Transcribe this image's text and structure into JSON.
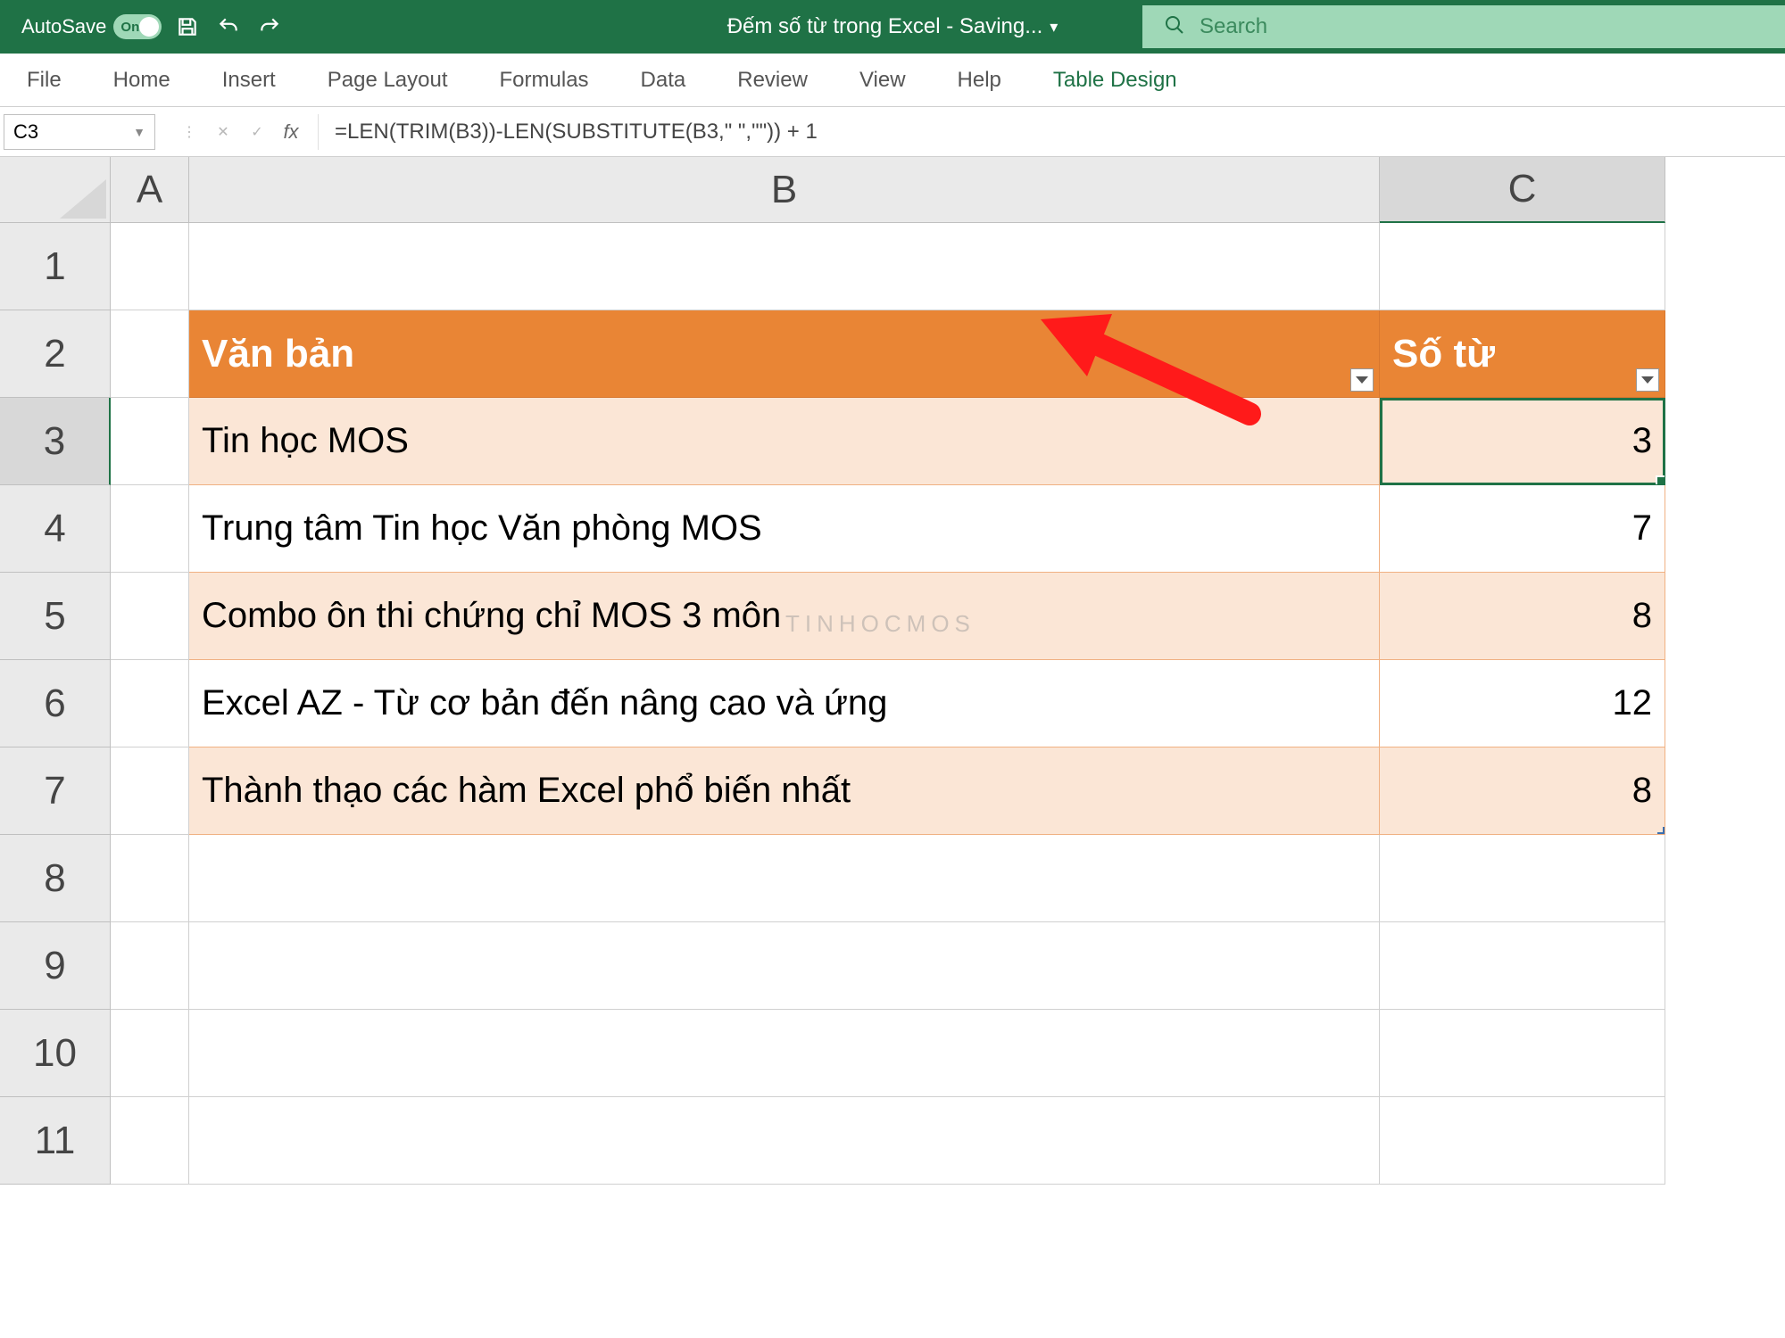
{
  "titlebar": {
    "autosave_label": "AutoSave",
    "toggle_label": "On",
    "doc_title": "Đếm số từ trong Excel  -  Saving..."
  },
  "search": {
    "placeholder": "Search"
  },
  "ribbon": {
    "tabs": [
      "File",
      "Home",
      "Insert",
      "Page Layout",
      "Formulas",
      "Data",
      "Review",
      "View",
      "Help",
      "Table Design"
    ],
    "active_index": 9
  },
  "namebox": {
    "value": "C3"
  },
  "formula": {
    "value": "=LEN(TRIM(B3))-LEN(SUBSTITUTE(B3,\" \",\"\")) + 1"
  },
  "column_headers": [
    "A",
    "B",
    "C"
  ],
  "row_headers": [
    "1",
    "2",
    "3",
    "4",
    "5",
    "6",
    "7",
    "8",
    "9",
    "10",
    "11"
  ],
  "table": {
    "header": {
      "col_b": "Văn bản",
      "col_c": "Số từ"
    },
    "rows": [
      {
        "text": "Tin học MOS",
        "count": "3"
      },
      {
        "text": "Trung tâm Tin học Văn phòng MOS",
        "count": "7"
      },
      {
        "text": "Combo ôn thi chứng chỉ MOS 3 môn",
        "count": "8"
      },
      {
        "text": "Excel AZ - Từ cơ bản đến nâng cao và ứng",
        "count": "12"
      },
      {
        "text": "Thành thạo các hàm Excel phổ biến nhất",
        "count": "8"
      }
    ]
  },
  "watermark": "TINHOCMOS"
}
